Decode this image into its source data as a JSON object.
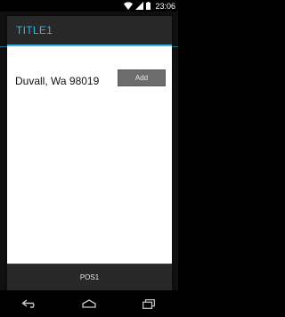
{
  "status_bar": {
    "time": "23:06",
    "icons": [
      "wifi-icon",
      "signal-icon",
      "battery-icon"
    ]
  },
  "dialog": {
    "title": "TITLE1",
    "address": "Duvall, Wa 98019",
    "add_label": "Add",
    "footer_label": "POS1"
  },
  "nav_bar": {
    "buttons": [
      "back-icon",
      "home-icon",
      "recents-icon"
    ]
  },
  "colors": {
    "accent": "#33b5e5",
    "header_bg": "#282828",
    "button_bg": "#6c6c6c"
  }
}
